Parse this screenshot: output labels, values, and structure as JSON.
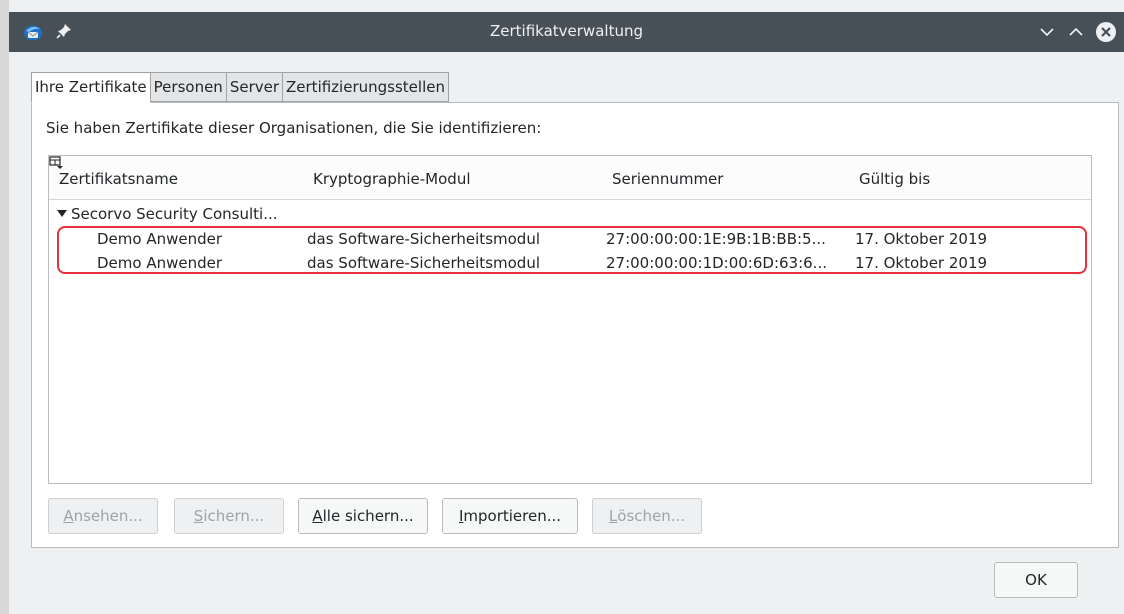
{
  "window": {
    "title": "Zertifikatverwaltung"
  },
  "tabs": [
    {
      "label": "Ihre Zertifikate",
      "active": true
    },
    {
      "label": "Personen",
      "active": false
    },
    {
      "label": "Server",
      "active": false
    },
    {
      "label": "Zertifizierungsstellen",
      "active": false
    }
  ],
  "panel": {
    "intro": "Sie haben Zertifikate dieser Organisationen, die Sie identifizieren:"
  },
  "tree": {
    "columns": [
      "Zertifikatsname",
      "Kryptographie-Modul",
      "Seriennummer",
      "Gültig bis"
    ],
    "group": "Secorvo Security Consulti...",
    "rows": [
      {
        "name": "Demo Anwender",
        "module": "das Software-Sicherheitsmodul",
        "serial": "27:00:00:00:1E:9B:1B:BB:5...",
        "valid": "17. Oktober 2019"
      },
      {
        "name": "Demo Anwender",
        "module": "das Software-Sicherheitsmodul",
        "serial": "27:00:00:00:1D:00:6D:63:6...",
        "valid": "17. Oktober 2019"
      }
    ]
  },
  "buttons": {
    "view": {
      "mnemonic": "A",
      "rest": "nsehen..."
    },
    "backup": {
      "mnemonic": "S",
      "rest": "ichern..."
    },
    "backup_all": {
      "mnemonic": "A",
      "rest": "lle sichern..."
    },
    "import": {
      "mnemonic": "I",
      "rest": "mportieren..."
    },
    "delete": {
      "mnemonic": "L",
      "rest": "öschen..."
    },
    "ok": "OK"
  },
  "colors": {
    "titlebar": "#475057",
    "highlight": "#e8303a",
    "close_button": "#eff0f1"
  }
}
